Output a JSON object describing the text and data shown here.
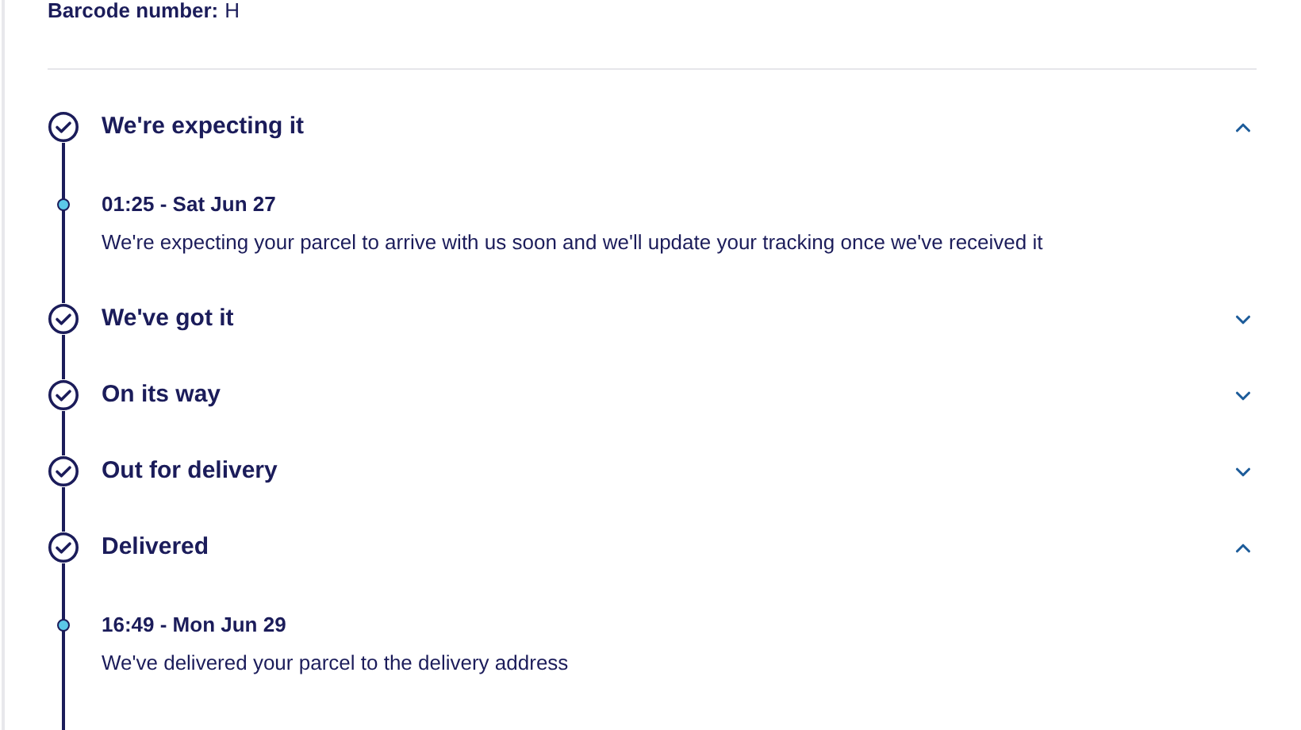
{
  "barcode": {
    "label": "Barcode number:",
    "value": "H"
  },
  "steps": [
    {
      "title": "We're expecting it",
      "completed": true,
      "expanded": true,
      "events": [
        {
          "time": "01:25 - Sat Jun 27",
          "description": "We're expecting your parcel to arrive with us soon and we'll update your tracking once we've received it"
        }
      ]
    },
    {
      "title": "We've got it",
      "completed": true,
      "expanded": false
    },
    {
      "title": "On its way",
      "completed": true,
      "expanded": false
    },
    {
      "title": "Out for delivery",
      "completed": true,
      "expanded": false
    },
    {
      "title": "Delivered",
      "completed": true,
      "expanded": true,
      "events": [
        {
          "time": "16:49 - Mon Jun 29",
          "description": "We've delivered your parcel to the delivery address"
        }
      ]
    }
  ]
}
